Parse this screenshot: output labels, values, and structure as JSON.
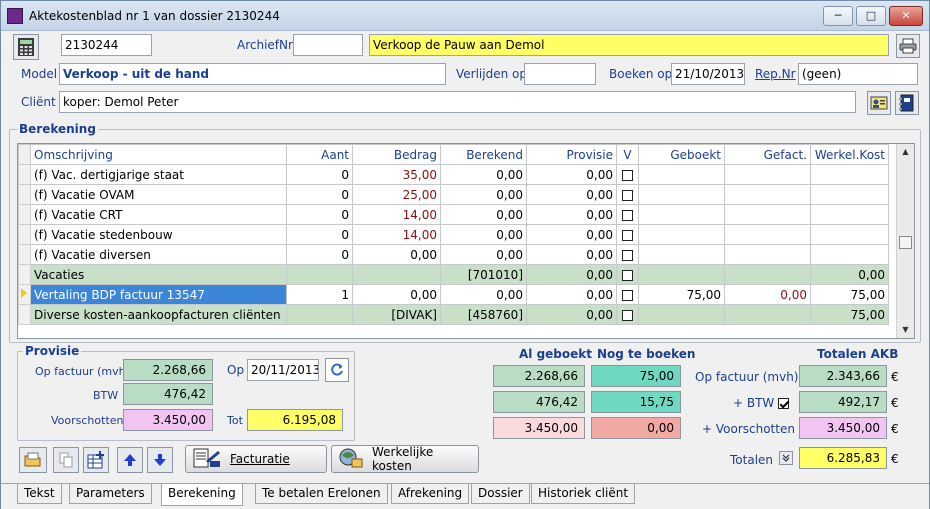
{
  "window": {
    "title": "Aktekostenblad nr 1 van dossier 2130244",
    "min": "─",
    "max": "□",
    "close": "✕"
  },
  "header": {
    "dossier_nr": "2130244",
    "archief_label": "ArchiefNr",
    "archief_value": "",
    "description": "Verkoop de Pauw aan Demol",
    "model_label": "Model",
    "model_value": "Verkoop - uit de hand",
    "verlijden_label": "Verlijden op",
    "verlijden_value": "",
    "boeken_label": "Boeken op",
    "boeken_value": "21/10/2013",
    "repnr_label": "Rep.Nr",
    "repnr_value": "(geen)",
    "client_label": "Cliënt",
    "client_value": "koper: Demol Peter"
  },
  "berekening": {
    "title": "Berekening",
    "columns": [
      "Omschrijving",
      "Aant",
      "Bedrag",
      "Berekend",
      "Provisie",
      "V",
      "Geboekt",
      "Gefact.",
      "Werkel.Kost"
    ],
    "rows": [
      {
        "omschr": "(f) Vac. dertigjarige staat",
        "aant": "0",
        "bedrag": "35,00",
        "berekend": "0,00",
        "provisie": "0,00",
        "v": false,
        "geboekt": "",
        "gefact": "",
        "werkel": "",
        "type": "normal"
      },
      {
        "omschr": "(f) Vacatie OVAM",
        "aant": "0",
        "bedrag": "25,00",
        "berekend": "0,00",
        "provisie": "0,00",
        "v": false,
        "geboekt": "",
        "gefact": "",
        "werkel": "",
        "type": "normal"
      },
      {
        "omschr": "(f) Vacatie CRT",
        "aant": "0",
        "bedrag": "14,00",
        "berekend": "0,00",
        "provisie": "0,00",
        "v": false,
        "geboekt": "",
        "gefact": "",
        "werkel": "",
        "type": "normal"
      },
      {
        "omschr": "(f) Vacatie stedenbouw",
        "aant": "0",
        "bedrag": "14,00",
        "berekend": "0,00",
        "provisie": "0,00",
        "v": false,
        "geboekt": "",
        "gefact": "",
        "werkel": "",
        "type": "normal"
      },
      {
        "omschr": "(f) Vacatie diversen",
        "aant": "0",
        "bedrag": "0,00",
        "berekend": "0,00",
        "provisie": "0,00",
        "v": false,
        "geboekt": "",
        "gefact": "",
        "werkel": "",
        "type": "normal-black"
      },
      {
        "omschr": "Vacaties",
        "aant": "",
        "bedrag": "",
        "berekend": "[701010]",
        "provisie": "0,00",
        "v": false,
        "geboekt": "",
        "gefact": "",
        "werkel": "0,00",
        "type": "green"
      },
      {
        "omschr": "Vertaling BDP factuur 13547",
        "aant": "1",
        "bedrag": "0,00",
        "berekend": "0,00",
        "provisie": "0,00",
        "v": false,
        "geboekt": "75,00",
        "gefact": "0,00",
        "werkel": "75,00",
        "type": "selected"
      },
      {
        "omschr": "Diverse kosten-aankoopfacturen cliënten",
        "aant": "",
        "bedrag": "[DIVAK]",
        "berekend": "[458760]",
        "provisie": "0,00",
        "v": false,
        "geboekt": "",
        "gefact": "",
        "werkel": "75,00",
        "type": "green-code"
      }
    ]
  },
  "provisie": {
    "title": "Provisie",
    "op_factuur_label": "Op factuur (mvh)",
    "op_factuur_value": "2.268,66",
    "op_label": "Op",
    "op_date": "20/11/2013",
    "btw_label": "BTW",
    "btw_value": "476,42",
    "voorschotten_label": "Voorschotten",
    "voorschotten_value": "3.450,00",
    "tot_label": "Tot",
    "tot_value": "6.195,08"
  },
  "summary": {
    "al_geboekt_label": "Al geboekt",
    "nog_label": "Nog te boeken",
    "totalen_akb_label": "Totalen AKB",
    "al_geboekt": [
      "2.268,66",
      "476,42",
      "3.450,00"
    ],
    "nog": [
      "75,00",
      "15,75",
      "0,00"
    ],
    "row_labels": [
      "Op factuur (mvh)",
      "+ BTW",
      "+ Voorschotten"
    ],
    "btw_checked": true,
    "totalen": [
      "2.343,66",
      "492,17",
      "3.450,00"
    ],
    "totalen_label": "Totalen",
    "grand_total": "6.285,83",
    "currency": "€"
  },
  "buttons": {
    "facturatie": "Facturatie",
    "werkelijke_kosten": "Werkelijke kosten"
  },
  "tabs": [
    "Tekst",
    "Parameters",
    "Berekening",
    "Te betalen Erelonen",
    "Afrekening",
    "Dossier",
    "Historiek cliënt"
  ],
  "active_tab": "Berekening",
  "colors": {
    "green": "#c8e0c8",
    "teal": "#6fd8c0",
    "yellow": "#ffff66",
    "pink": "#fbdadd",
    "violet": "#f2c4f2",
    "selected": "#3c86da"
  }
}
